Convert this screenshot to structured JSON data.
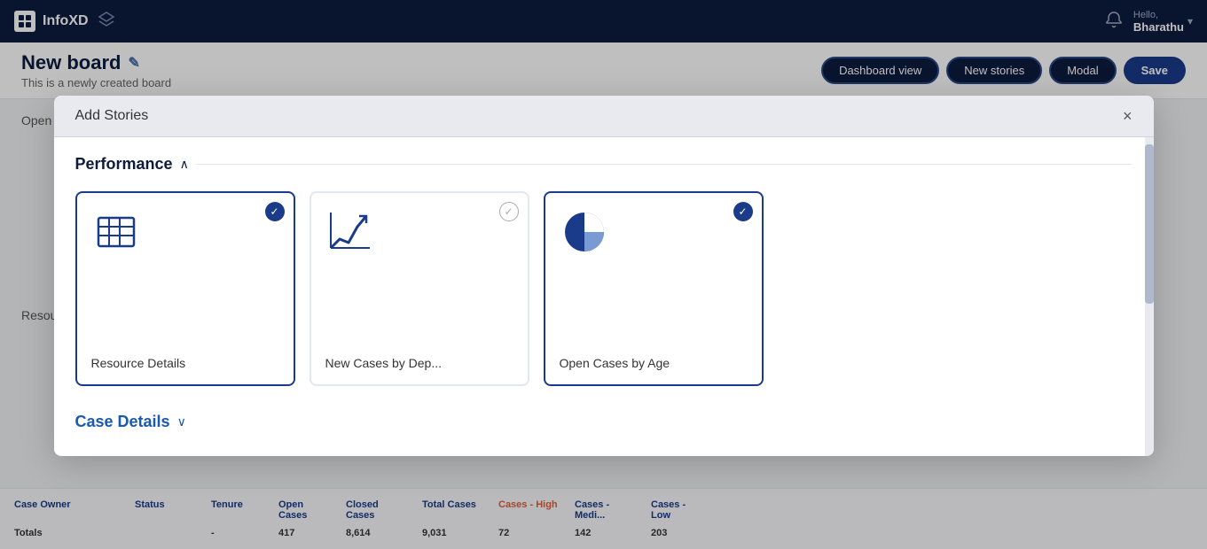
{
  "app": {
    "name": "InfoXD"
  },
  "navbar": {
    "logo_text": "InfoXD",
    "bell_label": "notifications",
    "user_hello": "Hello,",
    "user_name": "Bharathu",
    "chevron": "▾"
  },
  "page_header": {
    "title": "New board",
    "edit_icon": "✎",
    "subtitle": "This is a newly created board",
    "buttons": {
      "dashboard_view": "Dashboard view",
      "new_stories": "New stories",
      "modal": "Modal",
      "save": "Save"
    }
  },
  "background": {
    "section1": "Open",
    "section2": "Resou",
    "table": {
      "columns": [
        "Case Owner",
        "Status",
        "Tenure",
        "Open Cases",
        "Closed Cases",
        "Total Cases",
        "Cases - High",
        "Cases - Medi...",
        "Cases - Low"
      ],
      "totals_label": "Totals",
      "totals_values": [
        "-",
        "417",
        "8,614",
        "9,031",
        "72",
        "142",
        "203"
      ]
    }
  },
  "modal": {
    "title": "Add Stories",
    "close_icon": "×",
    "sections": [
      {
        "id": "performance",
        "title": "Performance",
        "toggle": "∧",
        "cards": [
          {
            "id": "resource-details",
            "label": "Resource Details",
            "icon_type": "table",
            "selected": true,
            "check_type": "filled"
          },
          {
            "id": "new-cases-by-dep",
            "label": "New Cases by Dep...",
            "icon_type": "trend",
            "selected": false,
            "check_type": "outline"
          },
          {
            "id": "open-cases-by-age",
            "label": "Open Cases by Age",
            "icon_type": "pie",
            "selected": true,
            "check_type": "filled"
          }
        ]
      },
      {
        "id": "case-details",
        "title": "Case Details",
        "toggle": "∨"
      }
    ]
  }
}
